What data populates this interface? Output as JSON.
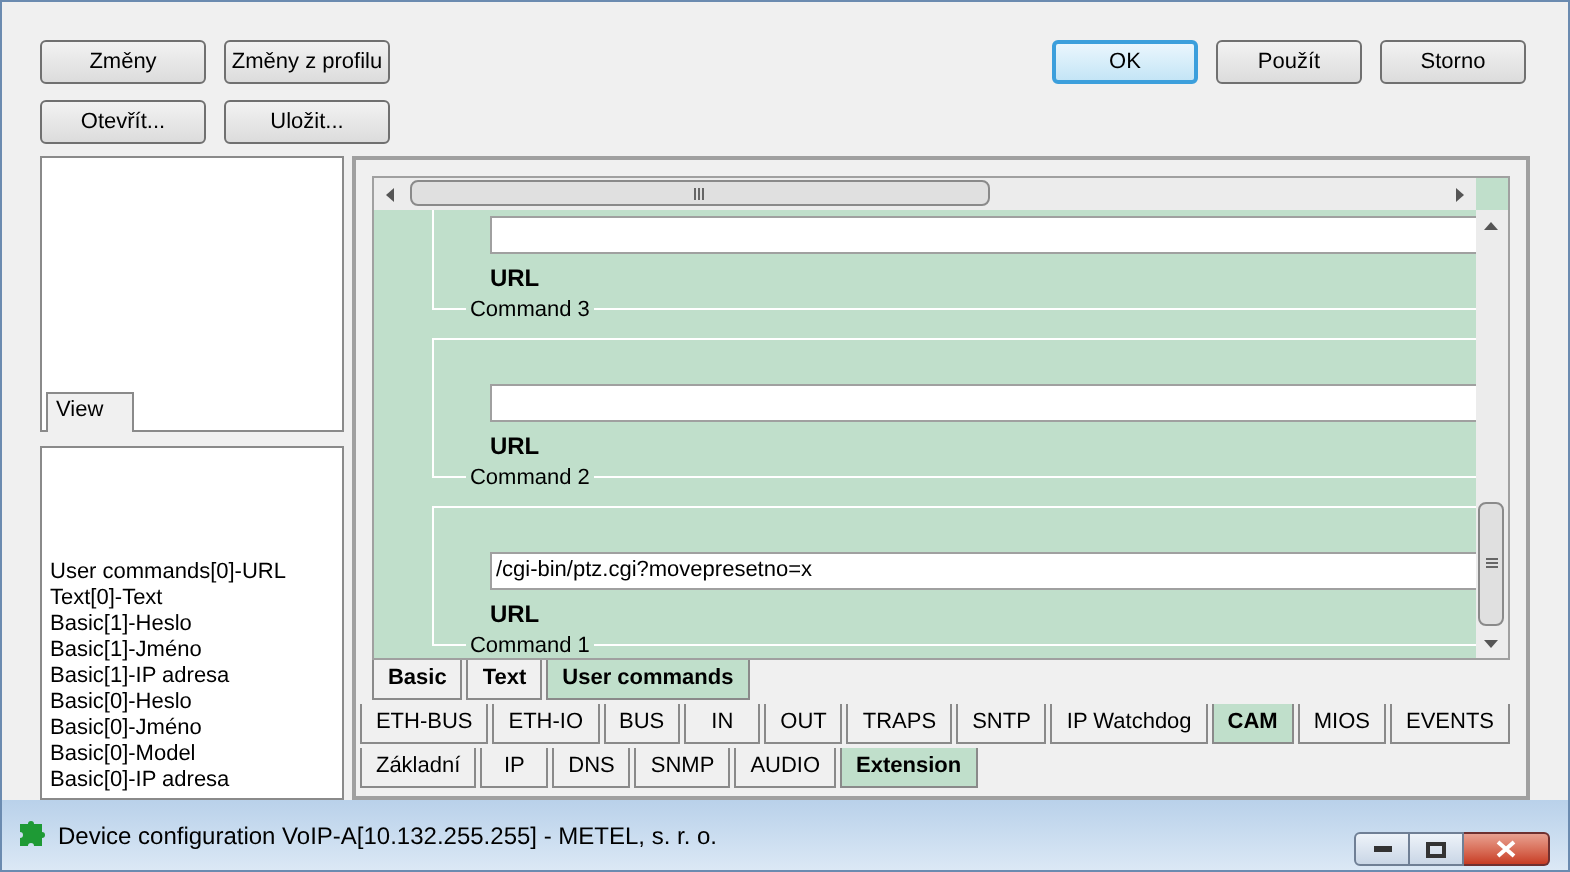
{
  "window": {
    "title": "Device configuration VoIP-A[10.132.255.255] - METEL, s. r. o."
  },
  "buttons_left": [
    {
      "label": "Změny"
    },
    {
      "label": "Změny z profilu"
    },
    {
      "label": "Otevřít..."
    },
    {
      "label": "Uložit..."
    }
  ],
  "buttons_right": [
    {
      "label": "OK",
      "default": true
    },
    {
      "label": "Použít",
      "default": false
    },
    {
      "label": "Storno",
      "default": false
    }
  ],
  "view_pane": {
    "tab": "View"
  },
  "field_list": [
    "User commands[0]-URL",
    "Text[0]-Text",
    "Basic[1]-Heslo",
    "Basic[1]-Jméno",
    "Basic[1]-IP adresa",
    "Basic[0]-Heslo",
    "Basic[0]-Jméno",
    "Basic[0]-Model",
    "Basic[0]-IP adresa"
  ],
  "main_tabs": [
    {
      "label": "Základní",
      "selected": false
    },
    {
      "label": "IP",
      "selected": false
    },
    {
      "label": "DNS",
      "selected": false
    },
    {
      "label": "SNMP",
      "selected": false
    },
    {
      "label": "AUDIO",
      "selected": false
    },
    {
      "label": "Extension",
      "selected": true
    }
  ],
  "extension_tabs": [
    {
      "label": "ETH-BUS",
      "selected": false
    },
    {
      "label": "ETH-IO",
      "selected": false
    },
    {
      "label": "BUS",
      "selected": false
    },
    {
      "label": "IN",
      "selected": false
    },
    {
      "label": "OUT",
      "selected": false
    },
    {
      "label": "TRAPS",
      "selected": false
    },
    {
      "label": "SNTP",
      "selected": false
    },
    {
      "label": "IP Watchdog",
      "selected": false
    },
    {
      "label": "CAM",
      "selected": true
    },
    {
      "label": "MIOS",
      "selected": false
    },
    {
      "label": "EVENTS",
      "selected": false
    }
  ],
  "cam_tabs": [
    {
      "label": "Basic",
      "selected": false
    },
    {
      "label": "Text",
      "selected": false
    },
    {
      "label": "User commands",
      "selected": true
    }
  ],
  "commands": [
    {
      "title": "Command 3",
      "field_label": "URL"
    },
    {
      "title": "Command 2",
      "field_label": "URL"
    },
    {
      "title": "Command 1",
      "field_label": "URL",
      "value": "/cgi-bin/ptz.cgi?movepresetno=x"
    }
  ]
}
